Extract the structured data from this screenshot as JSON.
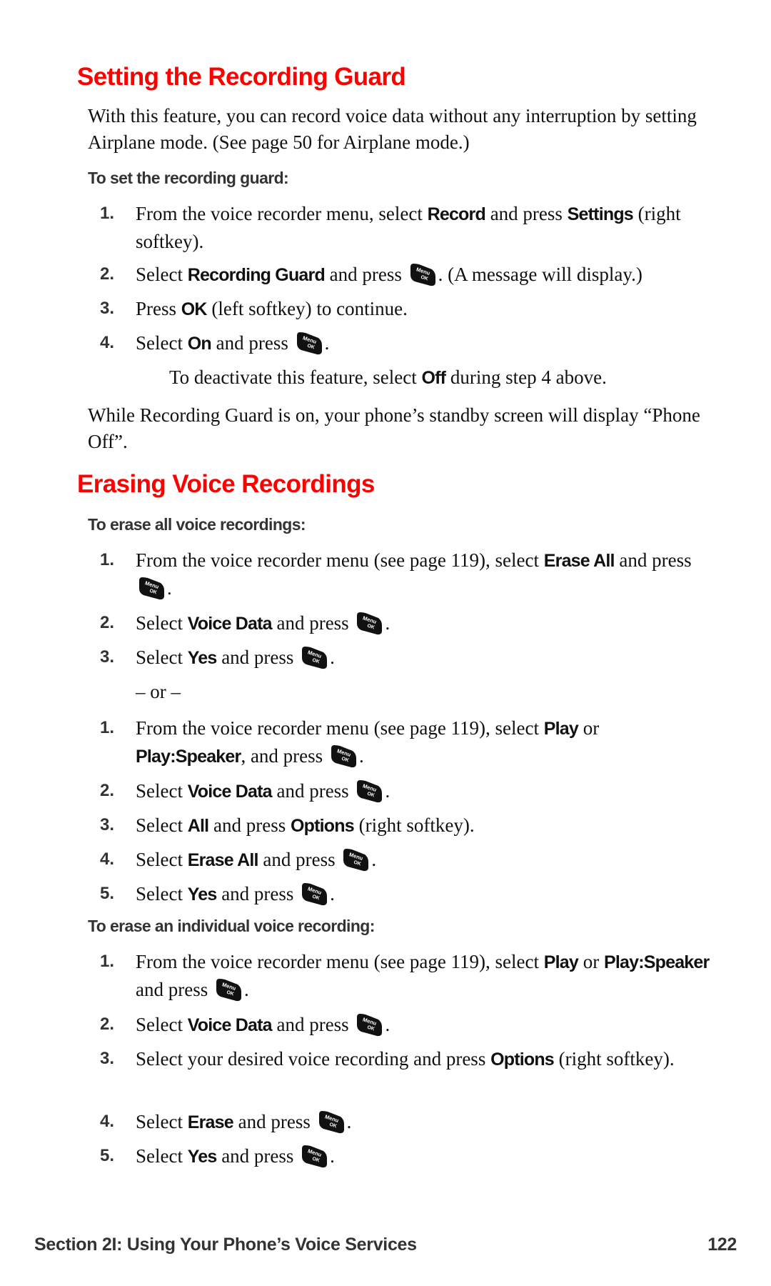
{
  "section1": {
    "title": "Setting the Recording Guard",
    "intro": "With this feature, you can record voice data without any interruption by setting Airplane mode. (See page 50 for Airplane mode.)",
    "subheading": "To set the recording guard:",
    "steps": [
      {
        "num": "1.",
        "pre": "From the voice recorder menu, select ",
        "b1": "Record",
        "mid": " and press ",
        "b2": "Settings",
        "post": " (right softkey)."
      },
      {
        "num": "2.",
        "pre": "Select ",
        "b1": "Recording Guard",
        "mid": " and press ",
        "post": ". (A message will display.)"
      },
      {
        "num": "3.",
        "pre": "Press ",
        "b1": "OK",
        "post": " (left softkey) to continue."
      },
      {
        "num": "4.",
        "pre": "Select ",
        "b1": "On",
        "mid": " and press ",
        "post": "."
      }
    ],
    "note": {
      "pre": "To deactivate this feature, select ",
      "b": "Off",
      "post": " during step 4 above."
    },
    "outro": "While Recording Guard is on, your phone’s standby screen will display “Phone Off”."
  },
  "section2": {
    "title": "Erasing Voice Recordings",
    "sub_all": "To erase all voice recordings:",
    "all_a": [
      {
        "num": "1.",
        "pre": "From the voice recorder menu (see page 119), select ",
        "b1": "Erase All",
        "mid": " and press ",
        "post": "."
      },
      {
        "num": "2.",
        "pre": "Select ",
        "b1": "Voice Data",
        "mid": " and press ",
        "post": "."
      },
      {
        "num": "3.",
        "pre": "Select ",
        "b1": "Yes",
        "mid": " and press ",
        "post": "."
      }
    ],
    "or": "– or –",
    "all_b": [
      {
        "num": "1.",
        "pre": "From the voice recorder menu (see page 119), select ",
        "b1": "Play",
        "mid1": " or ",
        "b2": "Play:Speaker",
        "mid": ", and press ",
        "post": "."
      },
      {
        "num": "2.",
        "pre": "Select ",
        "b1": "Voice Data",
        "mid": " and press ",
        "post": "."
      },
      {
        "num": "3.",
        "pre": "Select ",
        "b1": "All",
        "mid": " and press ",
        "b2": "Options",
        "post": " (right softkey)."
      },
      {
        "num": "4.",
        "pre": "Select ",
        "b1": "Erase All",
        "mid": " and press ",
        "post": "."
      },
      {
        "num": "5.",
        "pre": "Select ",
        "b1": "Yes",
        "mid": " and press ",
        "post": "."
      }
    ],
    "sub_individual": "To erase an individual voice recording:",
    "individual": [
      {
        "num": "1.",
        "pre": "From the voice recorder menu (see page 119), select ",
        "b1": "Play",
        "mid1": " or ",
        "b2": "Play:Speaker",
        "mid": " and press ",
        "post": "."
      },
      {
        "num": "2.",
        "pre": "Select ",
        "b1": "Voice Data",
        "mid": " and press ",
        "post": "."
      },
      {
        "num": "3.",
        "pre": "Select your desired voice recording and press ",
        "b1": "Options",
        "post": " (right softkey)."
      },
      {
        "num": "4.",
        "pre": "Select ",
        "b1": "Erase",
        "mid": " and press ",
        "post": "."
      },
      {
        "num": "5.",
        "pre": "Select ",
        "b1": "Yes",
        "mid": " and press ",
        "post": "."
      }
    ]
  },
  "icon": {
    "name": "menu-ok-key-icon",
    "line1": "Menu",
    "line2": "OK"
  },
  "footer": {
    "section": "Section 2I: Using Your Phone’s Voice Services",
    "page": "122"
  },
  "colors": {
    "heading": "#ff0000",
    "subheading": "#333333",
    "body": "#111111"
  }
}
